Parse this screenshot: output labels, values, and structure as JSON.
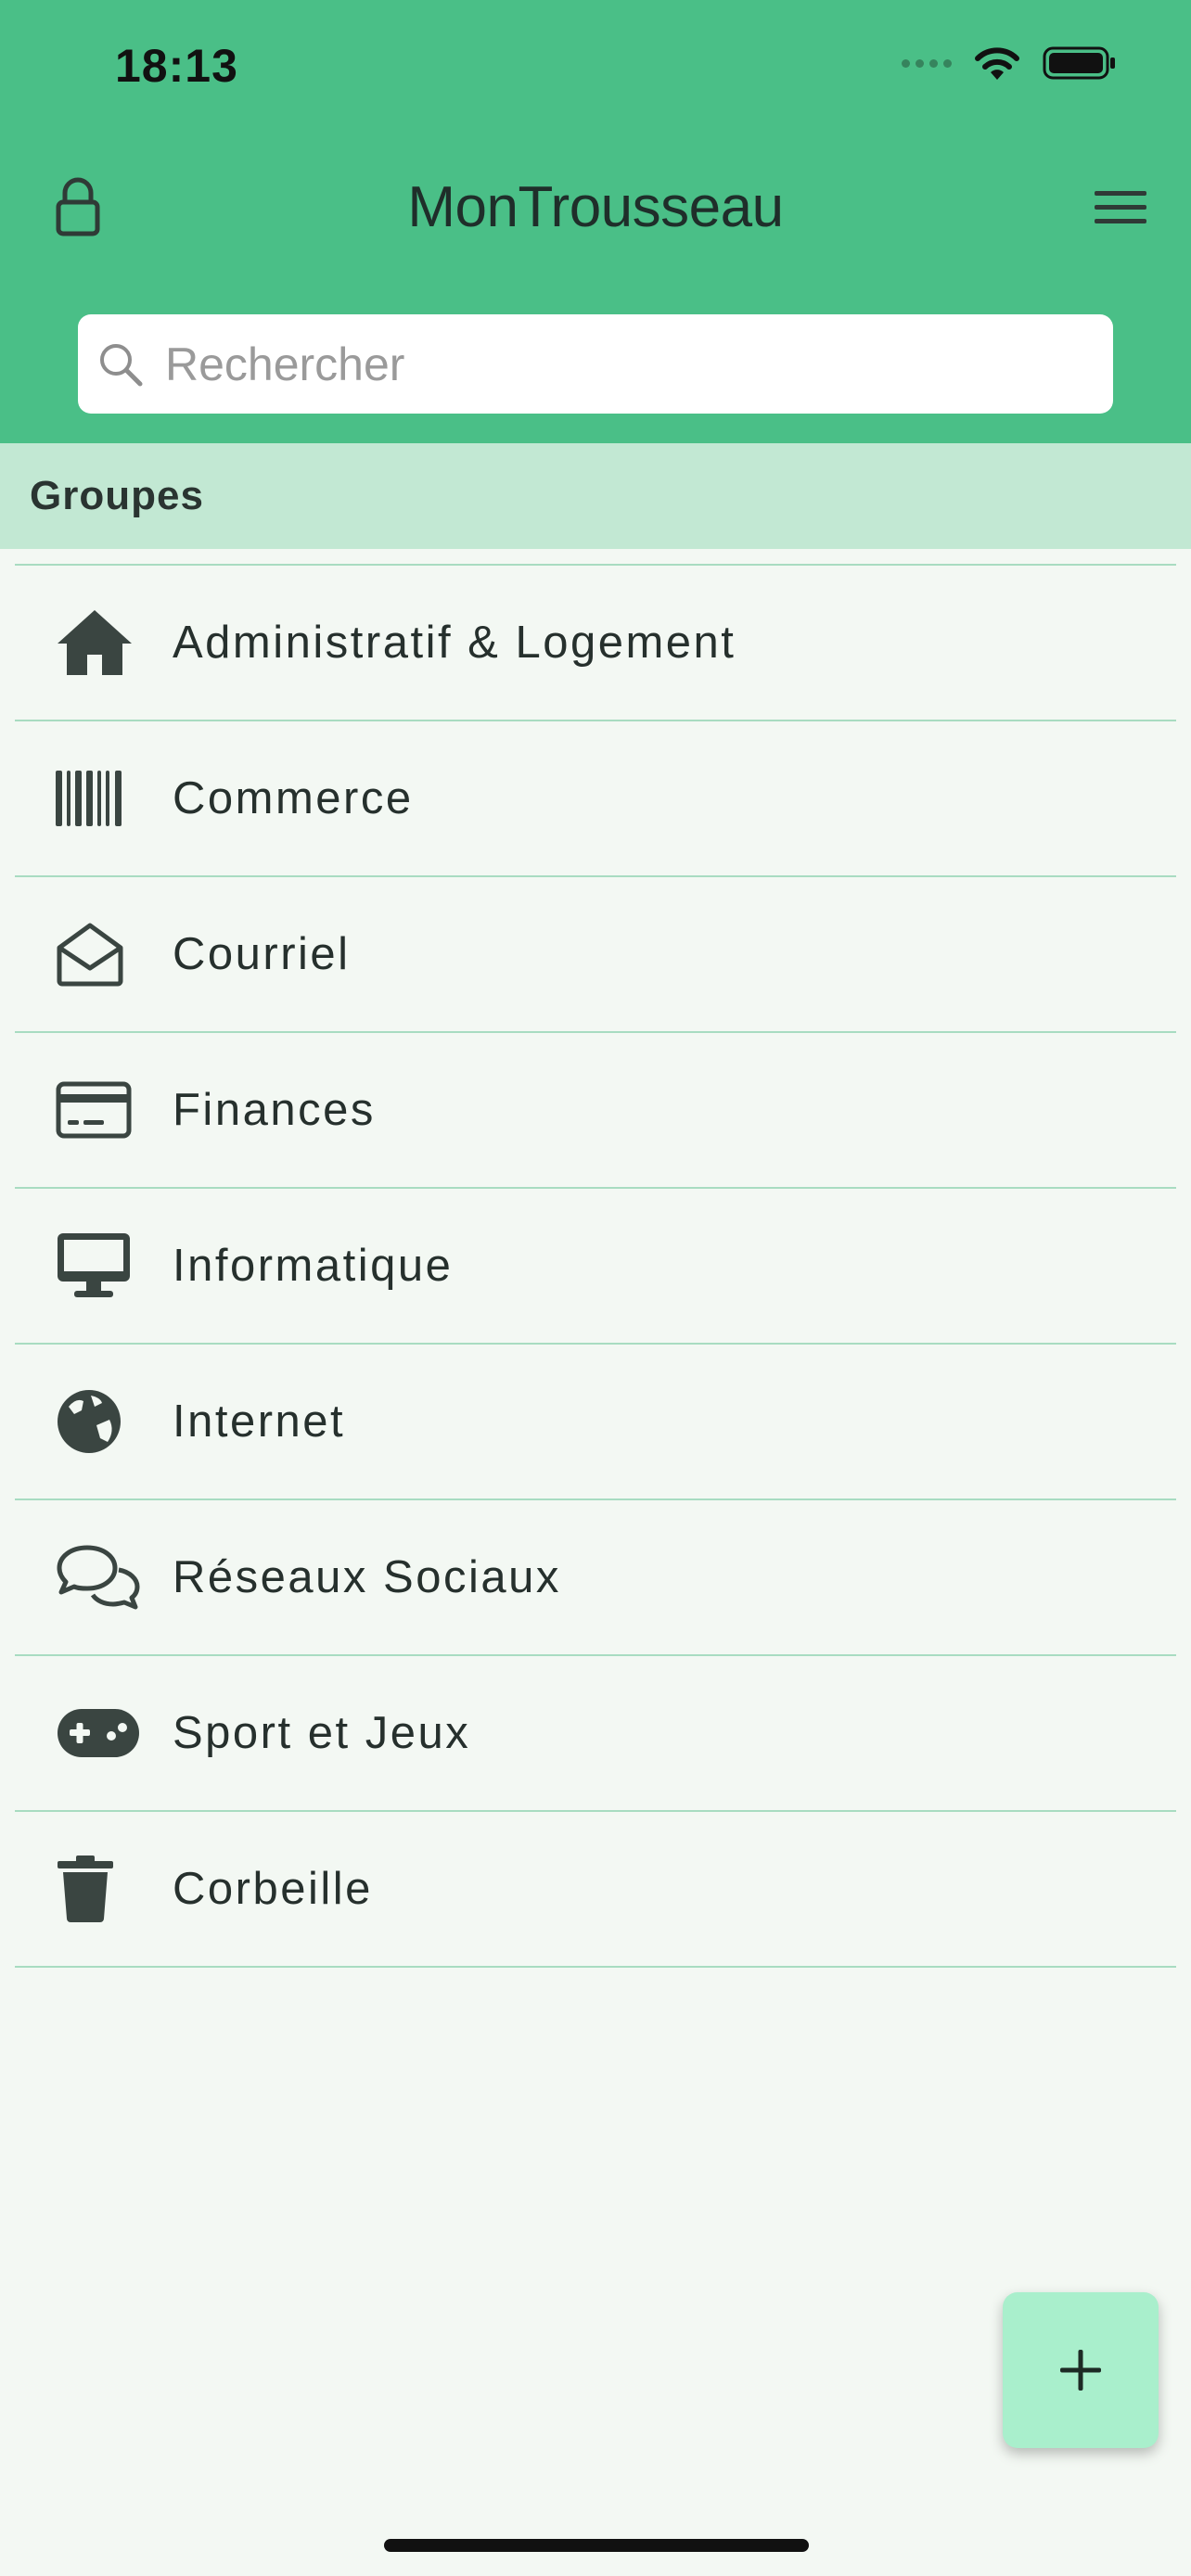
{
  "status_bar": {
    "time": "18:13"
  },
  "header": {
    "title": "MonTrousseau"
  },
  "search": {
    "placeholder": "Rechercher",
    "value": ""
  },
  "section": {
    "title": "Groupes"
  },
  "groups": [
    {
      "label": "Administratif & Logement",
      "icon": "house-icon"
    },
    {
      "label": "Commerce",
      "icon": "barcode-icon"
    },
    {
      "label": "Courriel",
      "icon": "envelope-open-icon"
    },
    {
      "label": "Finances",
      "icon": "credit-card-icon"
    },
    {
      "label": "Informatique",
      "icon": "desktop-icon"
    },
    {
      "label": "Internet",
      "icon": "globe-icon"
    },
    {
      "label": "Réseaux Sociaux",
      "icon": "comments-icon"
    },
    {
      "label": "Sport et Jeux",
      "icon": "gamepad-icon"
    },
    {
      "label": "Corbeille",
      "icon": "trash-icon"
    }
  ],
  "fab": {
    "label": "+"
  },
  "colors": {
    "header": "#4abf87",
    "section": "#c2e8d3",
    "background": "#f3f8f3",
    "divider": "#a8dcc1",
    "fab": "#a9efcc",
    "icon": "#3a4541"
  }
}
